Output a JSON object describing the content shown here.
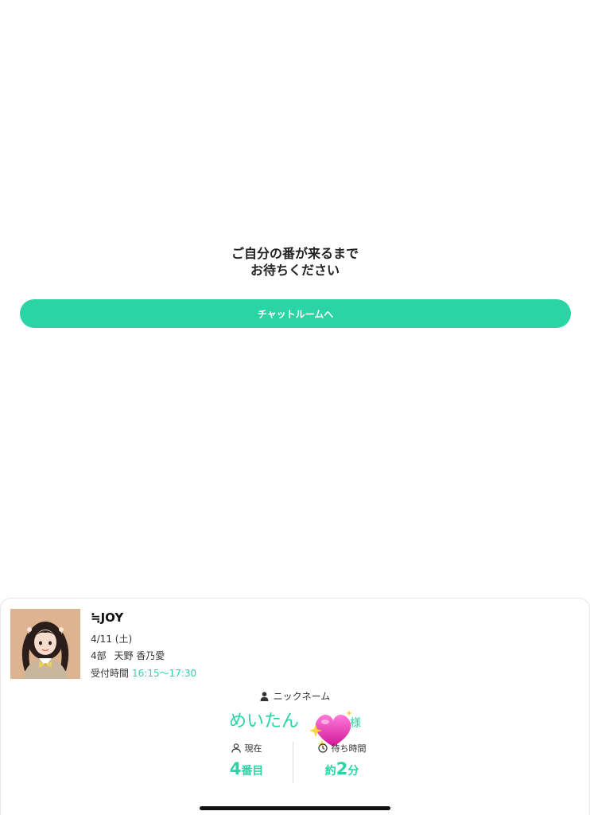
{
  "message": {
    "line1": "ご自分の番が来るまで",
    "line2": "お待ちください"
  },
  "chat_button": {
    "label": "チャットルームへ"
  },
  "event": {
    "group": "≒JOY",
    "date": "4/11 (土)",
    "part": "4部",
    "member": "天野 香乃愛",
    "reception_label": "受付時間",
    "reception_time": "16:15〜17:30"
  },
  "nickname": {
    "label": "ニックネーム",
    "value": "めいたん",
    "value_trailing": "様"
  },
  "status": {
    "current_label": "現在",
    "current_number": "4",
    "current_suffix": "番目",
    "wait_label": "待ち時間",
    "wait_prefix": "約",
    "wait_number": "2",
    "wait_suffix": "分"
  },
  "colors": {
    "accent": "#2bd4a5",
    "text": "#222222"
  },
  "icons": {
    "person": "person-icon",
    "clock": "clock-icon",
    "heart": "sparkling-heart-icon"
  }
}
